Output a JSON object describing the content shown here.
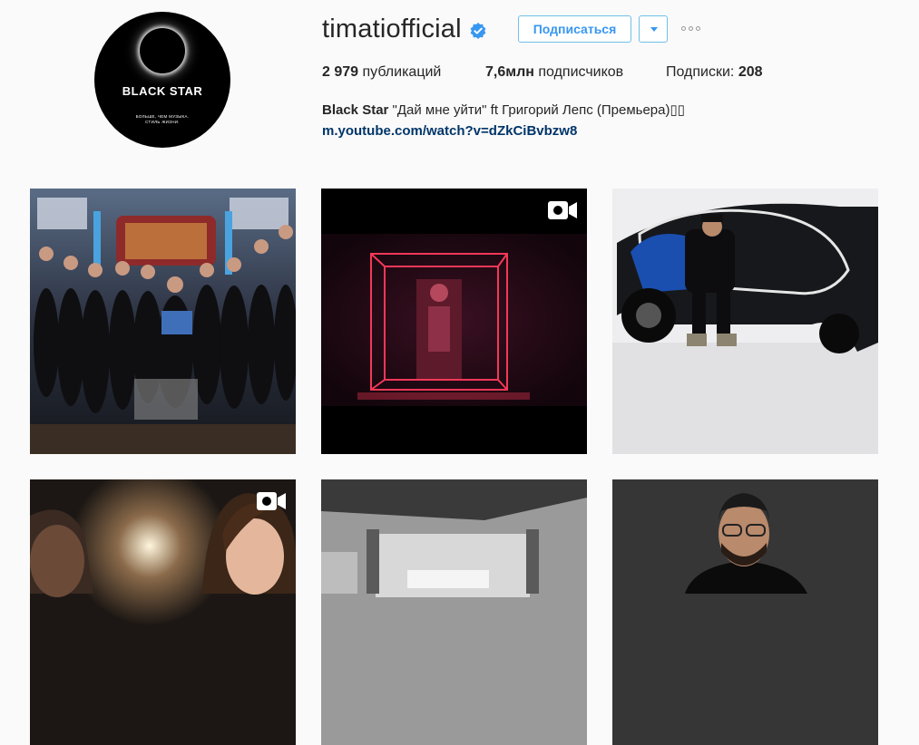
{
  "profile": {
    "username": "timatiofficial",
    "follow_label": "Подписаться",
    "posts_count": "2 979",
    "posts_label": "публикаций",
    "followers_count": "7,6млн",
    "followers_label": "подписчиков",
    "following_label": "Подписки:",
    "following_count": "208",
    "bio_name": "Black Star",
    "bio_text": "\"Дай мне уйти\" ft Григорий Лепс (Премьера)▯▯",
    "link": "m.youtube.com/watch?v=dZkCiBvbzw8"
  },
  "avatar": {
    "brand": "BLACK STAR",
    "tagline_1": "БОЛЬШЕ, ЧЕМ МУЗЫКА.",
    "tagline_2": "СТИЛЬ ЖИЗНИ."
  },
  "icons": {
    "verified": "verified-badge-icon",
    "dropdown": "triangle-down-icon",
    "more": "ellipsis-icon",
    "video": "video-camera-icon"
  },
  "colors": {
    "accent": "#3897f0",
    "verified": "#3897f0",
    "link": "#003569"
  },
  "posts": [
    {
      "type": "photo",
      "scene": "barbershop-group"
    },
    {
      "type": "video",
      "scene": "red-neon-cube"
    },
    {
      "type": "photo",
      "scene": "man-in-sports-car"
    },
    {
      "type": "video",
      "scene": "couple-close-up"
    },
    {
      "type": "photo",
      "scene": "black-and-white-interior"
    },
    {
      "type": "photo",
      "scene": "smiling-man-portrait"
    }
  ]
}
